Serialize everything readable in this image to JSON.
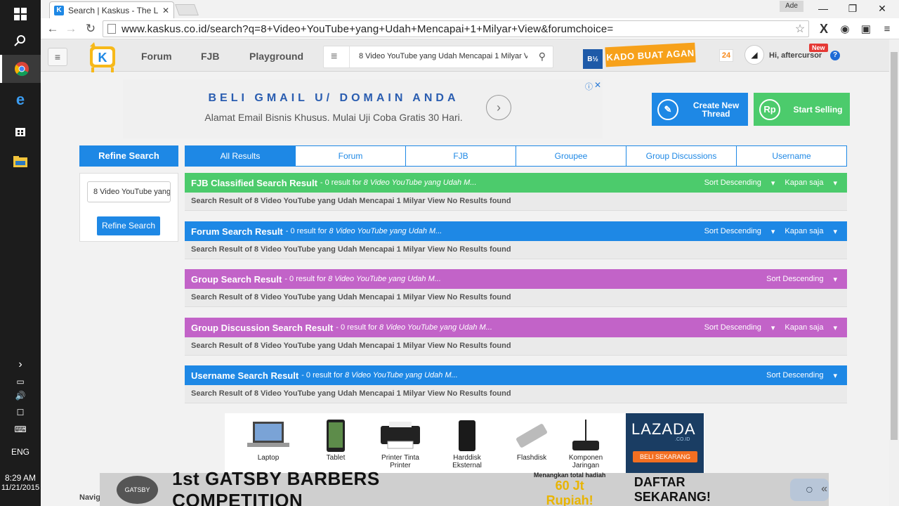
{
  "taskbar": {
    "tray_lang": "ENG",
    "time": "8:29 AM",
    "date": "11/21/2015"
  },
  "browser": {
    "tab_title": "Search | Kaskus - The Larg",
    "tab_favicon": "K",
    "user_label": "Ade",
    "url": "www.kaskus.co.id/search?q=8+Video+YouTube+yang+Udah+Mencapai+1+Milyar+View&forumchoice="
  },
  "header": {
    "nav": [
      "Forum",
      "FJB",
      "Playground"
    ],
    "search_value": "8 Video YouTube yang Udah Mencapai 1 Milyar View",
    "promo_badge": "B½",
    "promo": "KADO BUAT AGAN",
    "notif_count": "24",
    "greeting": "Hi, aftercursor",
    "new_badge": "New"
  },
  "ad_top": {
    "title": "BELI GMAIL U/ DOMAIN ANDA",
    "subtitle": "Alamat Email Bisnis Khusus. Mulai Uji Coba Gratis 30 Hari."
  },
  "actions": {
    "create_thread": "Create New Thread",
    "start_selling": "Start Selling",
    "selling_icon": "Rp"
  },
  "refine": {
    "heading": "Refine Search",
    "input_value": "8 Video YouTube yang Udah Mencapai 1 Milyar View",
    "button": "Refine Search"
  },
  "tabs": [
    "All Results",
    "Forum",
    "FJB",
    "Groupee",
    "Group Discussions",
    "Username"
  ],
  "results": [
    {
      "title": "FJB Classified Search Result",
      "count_text": " - 0 result for ",
      "query": "8 Video YouTube yang Udah M...",
      "sort": "Sort Descending",
      "time": "Kapan saja",
      "body": "Search Result of 8 Video YouTube yang Udah Mencapai 1 Milyar View No Results found",
      "color": "#4ccb6c"
    },
    {
      "title": "Forum Search Result",
      "count_text": " - 0 result for ",
      "query": "8 Video YouTube yang Udah M...",
      "sort": "Sort Descending",
      "time": "Kapan saja",
      "body": "Search Result of 8 Video YouTube yang Udah Mencapai 1 Milyar View No Results found",
      "color": "#1e88e5"
    },
    {
      "title": "Group Search Result",
      "count_text": " - 0 result for ",
      "query": "8 Video YouTube yang Udah M...",
      "sort": "Sort Descending",
      "time": "",
      "body": "Search Result of 8 Video YouTube yang Udah Mencapai 1 Milyar View No Results found",
      "color": "#c263c8"
    },
    {
      "title": "Group Discussion Search Result",
      "count_text": " - 0 result for ",
      "query": "8 Video YouTube yang Udah M...",
      "sort": "Sort Descending",
      "time": "Kapan saja",
      "body": "Search Result of 8 Video YouTube yang Udah Mencapai 1 Milyar View No Results found",
      "color": "#c263c8"
    },
    {
      "title": "Username Search Result",
      "count_text": " - 0 result for ",
      "query": "8 Video YouTube yang Udah M...",
      "sort": "Sort Descending",
      "time": "",
      "body": "Search Result of 8 Video YouTube yang Udah Mencapai 1 Milyar View No Results found",
      "color": "#1e88e5"
    }
  ],
  "ad_bottom": {
    "products": [
      "Laptop",
      "Tablet",
      "Printer Tinta Printer",
      "Harddisk Eksternal",
      "Flashdisk",
      "Komponen Jaringan"
    ],
    "brand": "LAZADA",
    "brand_sub": ".CO.ID",
    "brand_cta": "BELI SEKARANG"
  },
  "gatsby": {
    "logo": "GATSBY",
    "title": "1st GATSBY BARBERS COMPETITION",
    "prize_label": "Menangkan total hadiah",
    "prize": "60 Jt Rupiah!",
    "cta": "DAFTAR SEKARANG!"
  },
  "footer": {
    "nav_label": "Navig"
  }
}
